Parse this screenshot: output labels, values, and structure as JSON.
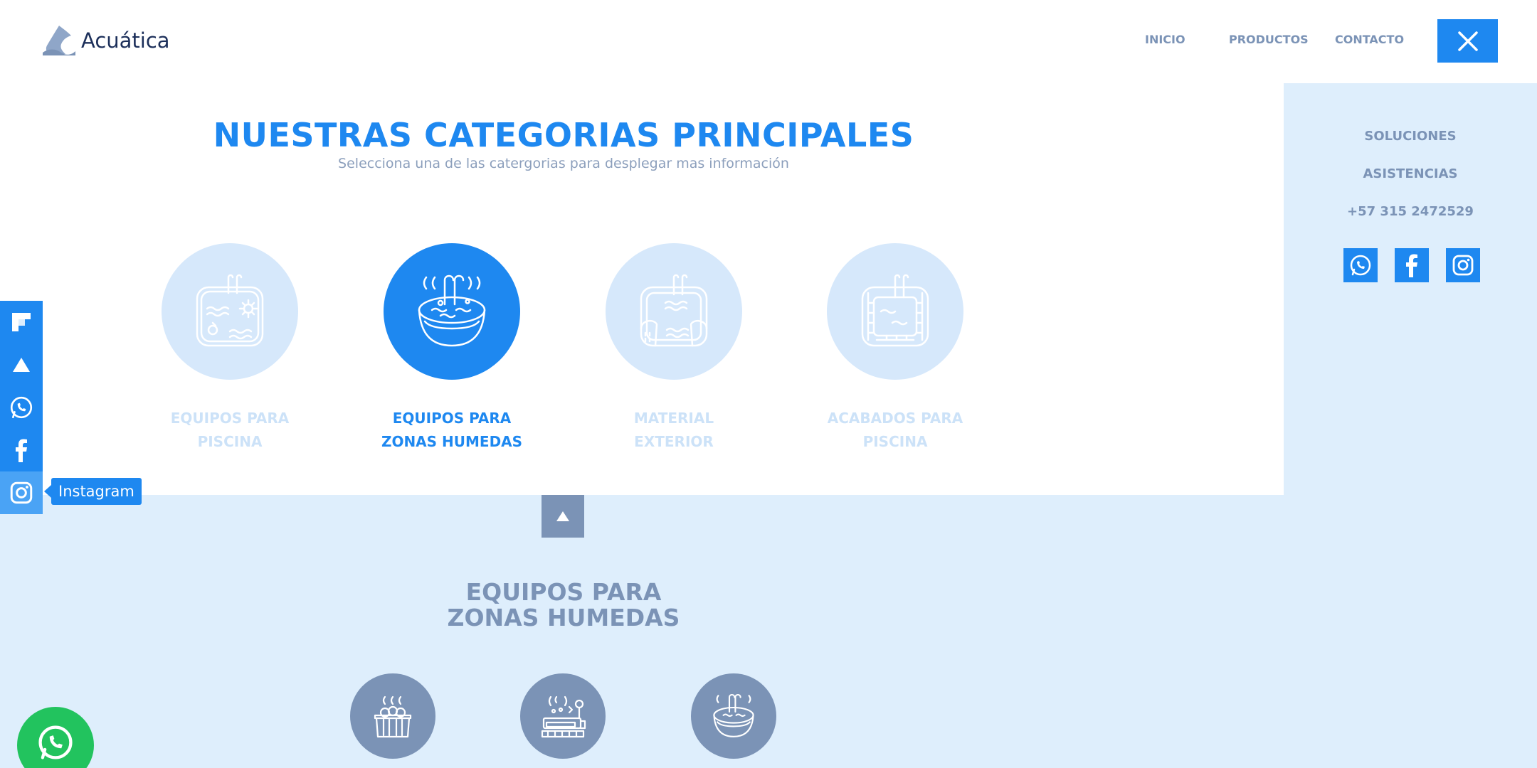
{
  "header": {
    "brand": "Acuática",
    "nav": {
      "inicio": "INICIO",
      "productos": "PRODUCTOS",
      "contacto": "CONTACTO"
    }
  },
  "side_panel": {
    "soluciones": "SOLUCIONES",
    "asistencias": "ASISTENCIAS",
    "phone": "+57 315 2472529",
    "socials": [
      "whatsapp-icon",
      "facebook-icon",
      "instagram-icon"
    ]
  },
  "categories_section": {
    "title": "NUESTRAS CATEGORIAS PRINCIPALES",
    "subtitle": "Selecciona una de las catergorias para desplegar mas información",
    "categories": [
      {
        "line1": "EQUIPOS PARA",
        "line2": "PISCINA",
        "active": false
      },
      {
        "line1": "EQUIPOS PARA",
        "line2": "ZONAS HUMEDAS",
        "active": true
      },
      {
        "line1": "MATERIAL",
        "line2": "EXTERIOR",
        "active": false
      },
      {
        "line1": "ACABADOS PARA",
        "line2": "PISCINA",
        "active": false
      }
    ]
  },
  "detail_section": {
    "title_line1": "EQUIPOS PARA",
    "title_line2": "ZONAS HUMEDAS"
  },
  "left_bar": {
    "items": [
      "flipboard-icon",
      "acuatica-logo-icon",
      "whatsapp-icon",
      "facebook-icon",
      "instagram-icon"
    ],
    "tooltip": "Instagram"
  },
  "colors": {
    "accent": "#1e88f0",
    "muted": "#7b93b6",
    "panel_bg": "#deeefc",
    "inactive_circle": "#d6e8fb",
    "whatsapp": "#22c35e"
  }
}
